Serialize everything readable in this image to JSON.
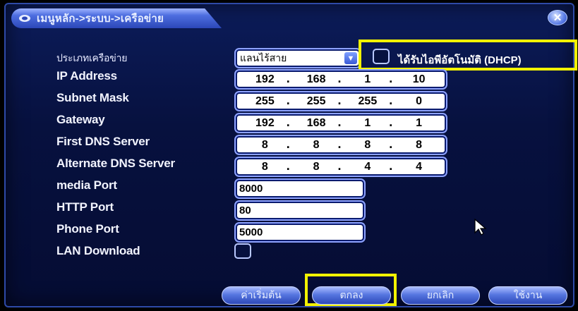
{
  "window": {
    "breadcrumb": "เมนูหลัก->ระบบ->เครือข่าย",
    "close_label": "✕"
  },
  "network_type": {
    "label": "ประเภทเครือข่าย",
    "value": "แลนไร้สาย",
    "arrow": "▼"
  },
  "dhcp": {
    "label": "ได้รับไอพีอัตโนมัติ (DHCP)",
    "checked": false
  },
  "fields": {
    "ip_address": {
      "label": "IP Address",
      "octets": [
        "192",
        "168",
        "1",
        "10"
      ]
    },
    "subnet_mask": {
      "label": "Subnet Mask",
      "octets": [
        "255",
        "255",
        "255",
        "0"
      ]
    },
    "gateway": {
      "label": "Gateway",
      "octets": [
        "192",
        "168",
        "1",
        "1"
      ]
    },
    "first_dns": {
      "label": "First DNS Server",
      "octets": [
        "8",
        "8",
        "8",
        "8"
      ]
    },
    "alt_dns": {
      "label": "Alternate DNS Server",
      "octets": [
        "8",
        "8",
        "4",
        "4"
      ]
    },
    "media_port": {
      "label": "media Port",
      "value": "8000"
    },
    "http_port": {
      "label": "HTTP Port",
      "value": "80"
    },
    "phone_port": {
      "label": "Phone Port",
      "value": "5000"
    },
    "lan_download": {
      "label": "LAN Download",
      "checked": false
    }
  },
  "buttons": {
    "default": "ค่าเริ่มต้น",
    "ok": "ตกลง",
    "cancel": "ยกเลิก",
    "apply": "ใช้งาน"
  },
  "colors": {
    "highlight": "#f2f200",
    "panel": "#07113f",
    "accent": "#4e6ee0"
  }
}
